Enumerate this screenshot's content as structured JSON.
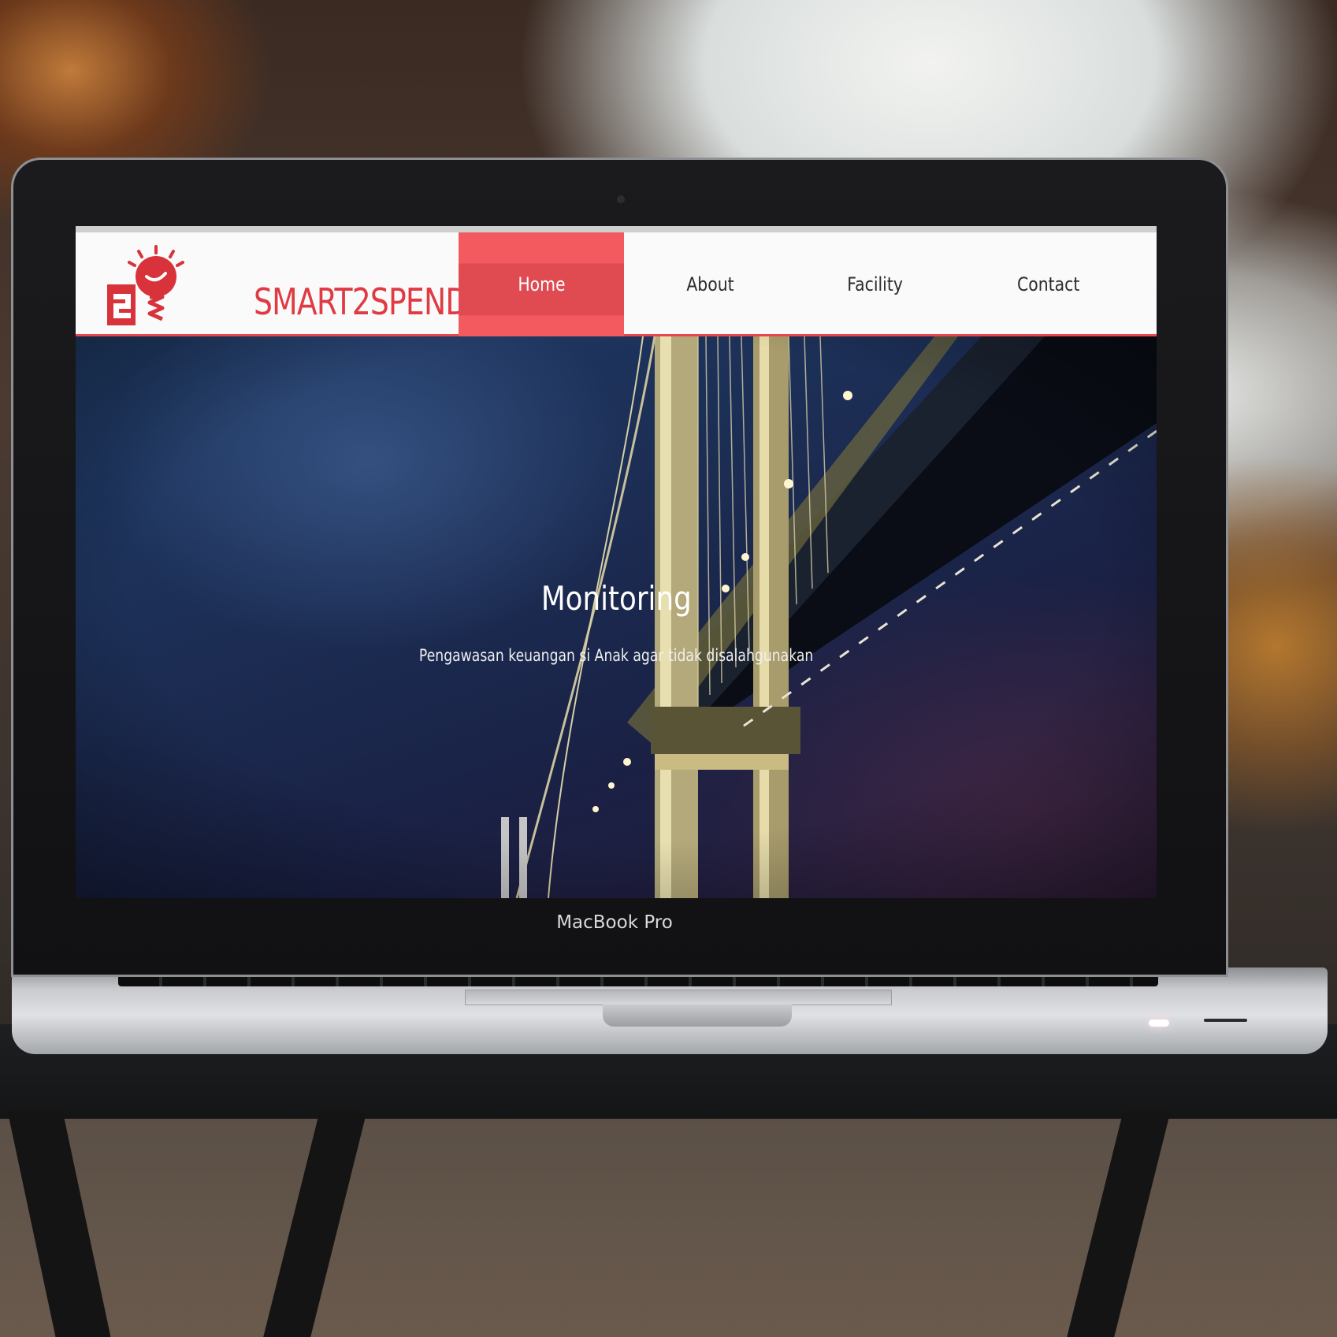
{
  "site": {
    "logo_text": "SMART2SPEND",
    "logo_icon": "lightbulb-mascot-icon",
    "accent_color": "#e8484d"
  },
  "nav": {
    "items": [
      {
        "label": "Home",
        "active": true
      },
      {
        "label": "About",
        "active": false
      },
      {
        "label": "Facility",
        "active": false
      },
      {
        "label": "Contact",
        "active": false
      }
    ]
  },
  "hero": {
    "title": "Monitoring",
    "subtitle": "Pengawasan keuangan si Anak agar tidak disalahgunakan",
    "background": "night-bridge-photo"
  },
  "device": {
    "label": "MacBook Pro"
  }
}
